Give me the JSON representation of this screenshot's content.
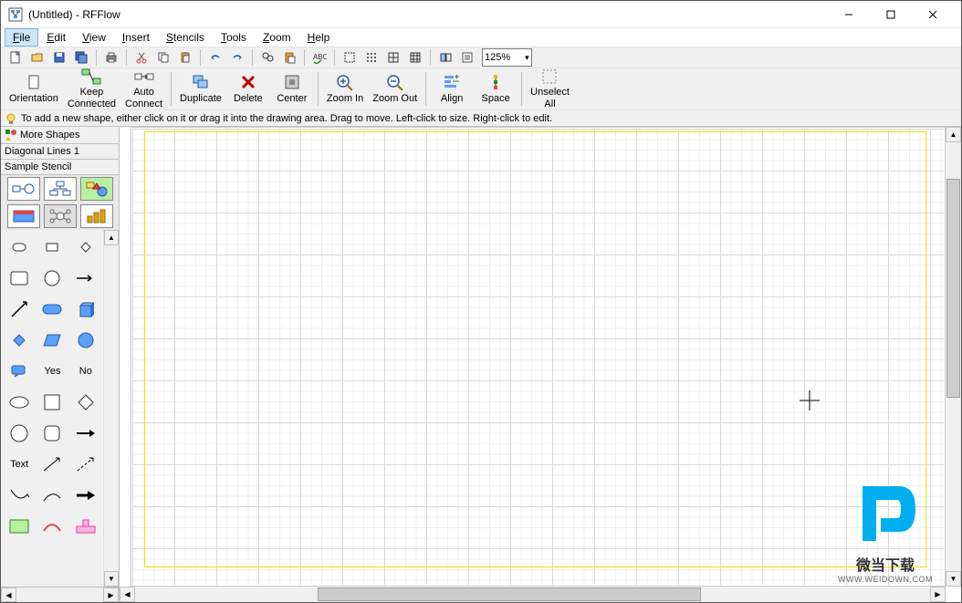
{
  "window": {
    "title": "(Untitled) - RFFlow"
  },
  "menus": [
    "File",
    "Edit",
    "View",
    "Insert",
    "Stencils",
    "Tools",
    "Zoom",
    "Help"
  ],
  "active_menu_index": 0,
  "zoom_value": "125%",
  "toolbar1_icons": [
    "new-icon",
    "open-icon",
    "save-icon",
    "save-all-icon",
    "sep",
    "print-icon",
    "sep",
    "cut-icon",
    "copy-icon",
    "paste-icon",
    "sep",
    "undo-icon",
    "redo-icon",
    "sep",
    "find-icon",
    "paste-special-icon",
    "sep",
    "spellcheck-icon",
    "sep",
    "select-icon",
    "dots-icon",
    "grid-icon",
    "grid2-icon",
    "sep",
    "flip-icon",
    "properties-icon"
  ],
  "toolbar2": [
    {
      "name": "orientation",
      "label": "Orientation"
    },
    {
      "name": "keep-connected",
      "label": "Keep",
      "label2": "Connected"
    },
    {
      "name": "auto-connect",
      "label": "Auto",
      "label2": "Connect"
    },
    {
      "sep": true
    },
    {
      "name": "duplicate",
      "label": "Duplicate"
    },
    {
      "name": "delete",
      "label": "Delete"
    },
    {
      "name": "center",
      "label": "Center"
    },
    {
      "sep": true
    },
    {
      "name": "zoom-in",
      "label": "Zoom In"
    },
    {
      "name": "zoom-out",
      "label": "Zoom Out"
    },
    {
      "sep": true
    },
    {
      "name": "align",
      "label": "Align"
    },
    {
      "name": "space",
      "label": "Space"
    },
    {
      "sep": true
    },
    {
      "name": "unselect-all",
      "label": "Unselect",
      "label2": "All"
    }
  ],
  "hint_text": "To add a new shape, either click on it or drag it into the drawing area. Drag to move. Left-click to size. Right-click to edit.",
  "sidebar": {
    "more_shapes": "More Shapes",
    "sect1": "Diagonal Lines 1",
    "sect2": "Sample Stencil",
    "shapes": [
      "flowchart",
      "orgchart",
      "shapes-set",
      "cardset",
      "network",
      "bars",
      "small-rect",
      "small-rect2",
      "small-diamond",
      "rounded-rect",
      "circle",
      "arrow-right",
      "arrow-up",
      "pill-blue",
      "cube-blue",
      "diamond-blue",
      "parallelogram",
      "ellipse-blue",
      "callout",
      "yes",
      "no",
      "ellipse",
      "square",
      "diamond",
      "circle2",
      "rounded-square",
      "arrow-right2",
      "text",
      "arrow-thin",
      "arrow-dashed",
      "curve1",
      "curve2",
      "curve3",
      "green-rect",
      "red-tri",
      "pink-t"
    ],
    "shape_labels": {
      "text": "Text",
      "yes": "Yes",
      "no": "No"
    }
  },
  "watermark": {
    "line1": "微当下载",
    "line2": "WWW.WEIDOWN.COM"
  }
}
